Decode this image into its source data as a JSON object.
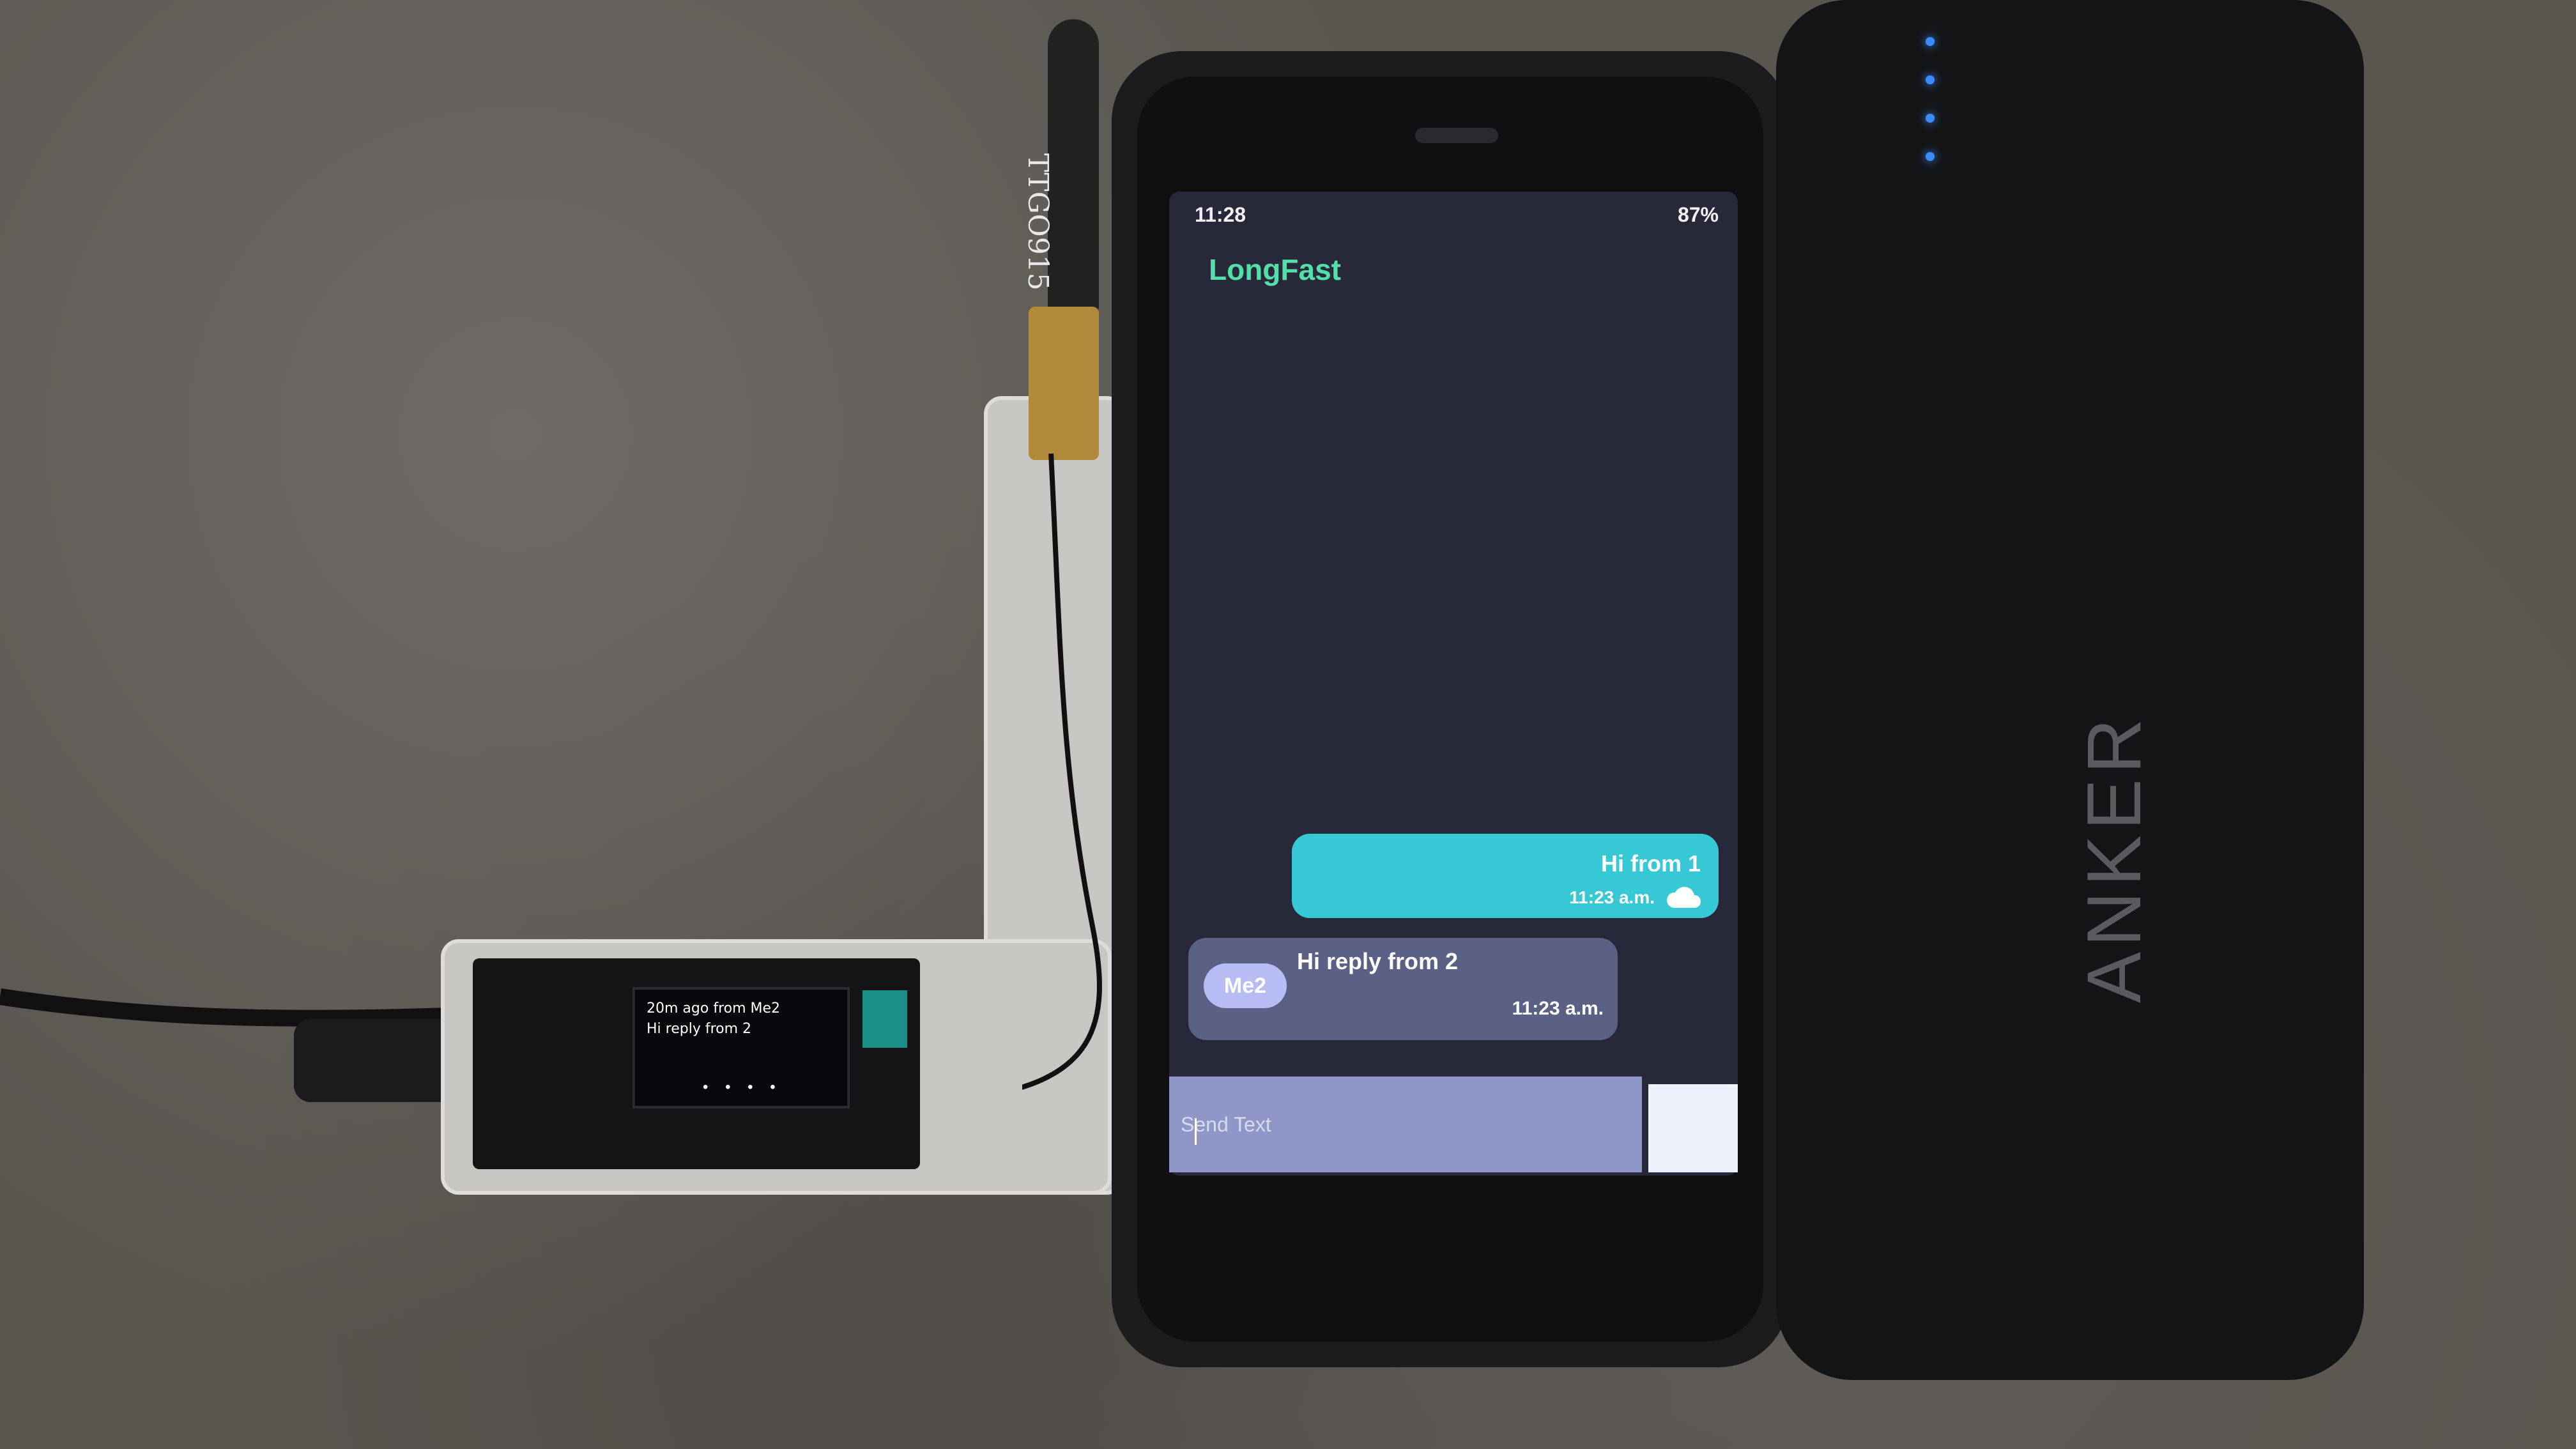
{
  "phone": {
    "status_time": "11:28",
    "status_battery": "87%",
    "channel_title": "LongFast",
    "messages": [
      {
        "text": "Hi from 1",
        "time": "11:23 a.m."
      },
      {
        "sender": "Me2",
        "text": "Hi reply from 2",
        "time": "11:23 a.m."
      }
    ],
    "compose_placeholder": "Send Text"
  },
  "device": {
    "oled_line_1": "20m ago from Me2",
    "oled_line_2": "Hi reply from 2",
    "oled_dots": "• • • •",
    "antenna_label": "TTGO915"
  },
  "powerbank": {
    "brand": "ANKER"
  },
  "colors": {
    "channel_title": "#52e0a8",
    "outgoing_bubble": "#36c8d4",
    "incoming_bubble": "#5b6085",
    "led": "#3a8cff"
  }
}
